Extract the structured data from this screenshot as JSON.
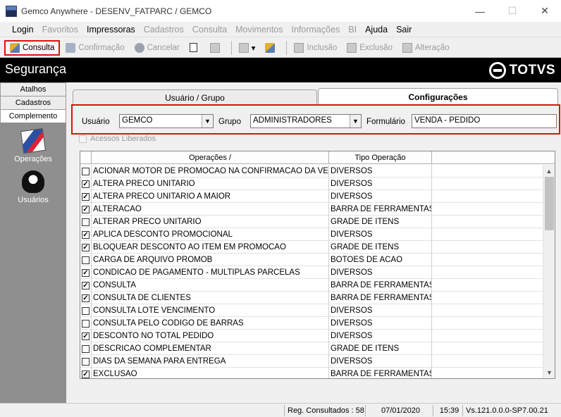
{
  "window": {
    "title": "Gemco Anywhere - DESENV_FATPARC / GEMCO",
    "controls": [
      "—",
      "☐",
      "✕"
    ]
  },
  "menu": [
    {
      "label": "Login",
      "enabled": true
    },
    {
      "label": "Favoritos",
      "enabled": false
    },
    {
      "label": "Impressoras",
      "enabled": true
    },
    {
      "label": "Cadastros",
      "enabled": false
    },
    {
      "label": "Consulta",
      "enabled": false
    },
    {
      "label": "Movimentos",
      "enabled": false
    },
    {
      "label": "Informações",
      "enabled": false
    },
    {
      "label": "BI",
      "enabled": false
    },
    {
      "label": "Ajuda",
      "enabled": true
    },
    {
      "label": "Sair",
      "enabled": true
    }
  ],
  "toolbar": {
    "consulta": "Consulta",
    "confirmacao": "Confirmação",
    "cancelar": "Cancelar",
    "inclusao": "Inclusão",
    "exclusao": "Exclusão",
    "alteracao": "Alteração"
  },
  "header": {
    "title": "Segurança",
    "logo": "TOTVS"
  },
  "sidebar": {
    "tabs": [
      "Atalhos",
      "Cadastros",
      "Complemento"
    ],
    "launchers": [
      {
        "label": "Operações",
        "icon": "operations-icon"
      },
      {
        "label": "Usuários",
        "icon": "users-icon"
      }
    ]
  },
  "tabs": {
    "usuario_grupo": "Usuário  / Grupo",
    "configuracoes": "Configurações"
  },
  "filters": {
    "usuario_label": "Usuário",
    "usuario_value": "GEMCO",
    "grupo_label": "Grupo",
    "grupo_value": "ADMINISTRADORES",
    "formulario_label": "Formulário",
    "formulario_value": "VENDA - PEDIDO"
  },
  "acessos_liberados": "Acessos Liberados",
  "grid": {
    "col_operacoes": "Operações  /",
    "col_tipo": "Tipo Operação",
    "rows": [
      {
        "checked": false,
        "op": "ACIONAR MOTOR DE PROMOCAO NA CONFIRMACAO DA VENDA",
        "tipo": "DIVERSOS"
      },
      {
        "checked": true,
        "op": "ALTERA PRECO UNITARIO",
        "tipo": "DIVERSOS"
      },
      {
        "checked": true,
        "op": "ALTERA PRECO UNITARIO A MAIOR",
        "tipo": "DIVERSOS"
      },
      {
        "checked": true,
        "op": "ALTERACAO",
        "tipo": "BARRA DE FERRAMENTAS"
      },
      {
        "checked": false,
        "op": "ALTERAR PRECO UNITARIO",
        "tipo": "GRADE DE ITENS"
      },
      {
        "checked": true,
        "op": "APLICA DESCONTO PROMOCIONAL",
        "tipo": "DIVERSOS"
      },
      {
        "checked": true,
        "op": "BLOQUEAR DESCONTO AO ITEM EM PROMOCAO",
        "tipo": "GRADE DE ITENS"
      },
      {
        "checked": false,
        "op": "CARGA DE ARQUIVO PROMOB",
        "tipo": "BOTOES DE ACAO"
      },
      {
        "checked": true,
        "op": "CONDICAO DE PAGAMENTO - MULTIPLAS PARCELAS",
        "tipo": "DIVERSOS"
      },
      {
        "checked": true,
        "op": "CONSULTA",
        "tipo": "BARRA DE FERRAMENTAS"
      },
      {
        "checked": true,
        "op": "CONSULTA DE CLIENTES",
        "tipo": "BARRA DE FERRAMENTAS"
      },
      {
        "checked": false,
        "op": "CONSULTA LOTE VENCIMENTO",
        "tipo": "DIVERSOS"
      },
      {
        "checked": false,
        "op": "CONSULTA PELO CODIGO DE BARRAS",
        "tipo": "DIVERSOS"
      },
      {
        "checked": true,
        "op": "DESCONTO NO TOTAL PEDIDO",
        "tipo": "DIVERSOS"
      },
      {
        "checked": false,
        "op": "DESCRICAO COMPLEMENTAR",
        "tipo": "GRADE DE ITENS"
      },
      {
        "checked": false,
        "op": "DIAS DA SEMANA PARA ENTREGA",
        "tipo": "DIVERSOS"
      },
      {
        "checked": true,
        "op": "EXCLUSAO",
        "tipo": "BARRA DE FERRAMENTAS"
      }
    ]
  },
  "status": {
    "reg": "Reg. Consultados : 58",
    "date": "07/01/2020",
    "time": "15:39",
    "version": "Vs.121.0.0.0-SP7.00.21"
  }
}
